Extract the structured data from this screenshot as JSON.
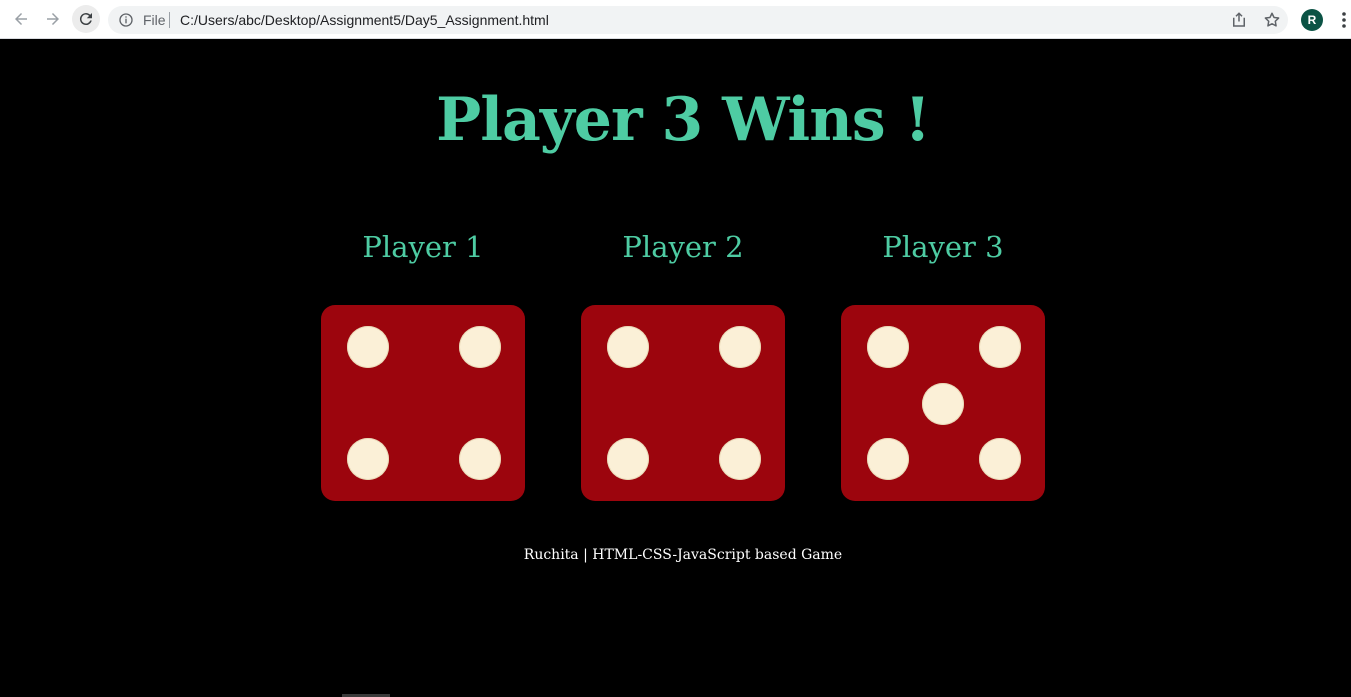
{
  "browser": {
    "scheme_label": "File",
    "url": "C:/Users/abc/Desktop/Assignment5/Day5_Assignment.html",
    "profile_initial": "R",
    "icons": [
      "back-arrow-icon",
      "forward-arrow-icon",
      "reload-icon",
      "info-icon",
      "share-icon",
      "star-icon",
      "kebab-menu-icon"
    ]
  },
  "game": {
    "result": "Player 3 Wins !",
    "players": [
      {
        "name": "Player 1",
        "die_value": 4
      },
      {
        "name": "Player 2",
        "die_value": 4
      },
      {
        "name": "Player 3",
        "die_value": 5
      }
    ],
    "footer": "Ruchita | HTML-CSS-JavaScript based Game"
  },
  "colors": {
    "accent": "#4ecca3",
    "die_face": "#9c050d",
    "pip": "#fbf0d7",
    "background": "#000000"
  }
}
